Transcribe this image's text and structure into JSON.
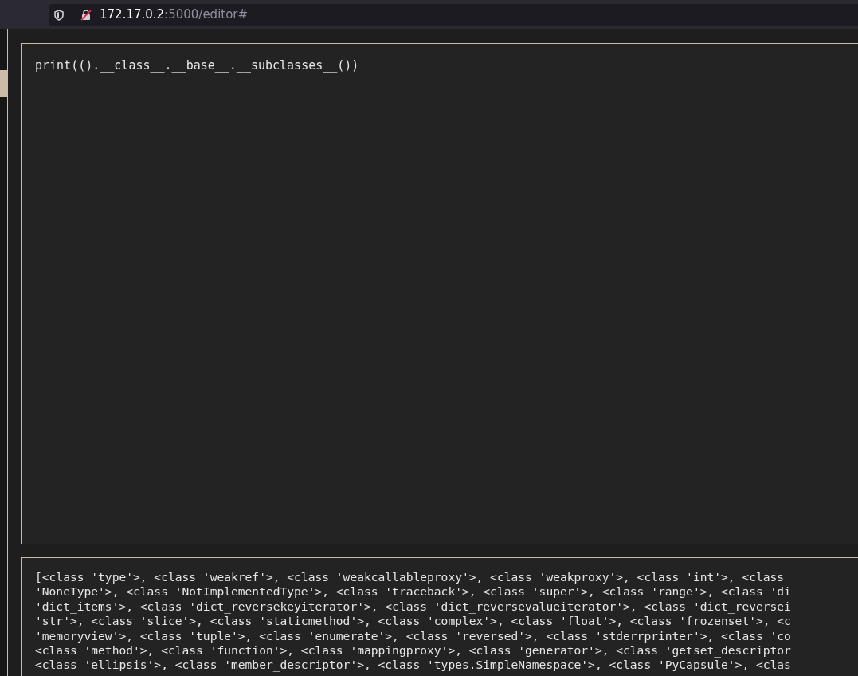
{
  "address_bar": {
    "host": "172.17.0.2",
    "rest": ":5000/editor#"
  },
  "editor": {
    "code": "print(().__class__.__base__.__subclasses__())"
  },
  "output": {
    "lines": [
      "[<class 'type'>, <class 'weakref'>, <class 'weakcallableproxy'>, <class 'weakproxy'>, <class 'int'>, <class",
      "'NoneType'>, <class 'NotImplementedType'>, <class 'traceback'>, <class 'super'>, <class 'range'>, <class 'di",
      "'dict_items'>, <class 'dict_reversekeyiterator'>, <class 'dict_reversevalueiterator'>, <class 'dict_reversei",
      "'str'>, <class 'slice'>, <class 'staticmethod'>, <class 'complex'>, <class 'float'>, <class 'frozenset'>, <c",
      "'memoryview'>, <class 'tuple'>, <class 'enumerate'>, <class 'reversed'>, <class 'stderrprinter'>, <class 'co",
      "<class 'method'>, <class 'function'>, <class 'mappingproxy'>, <class 'generator'>, <class 'getset_descriptor",
      "<class 'ellipsis'>, <class 'member_descriptor'>, <class 'types.SimpleNamespace'>, <class 'PyCapsule'>, <clas"
    ]
  }
}
